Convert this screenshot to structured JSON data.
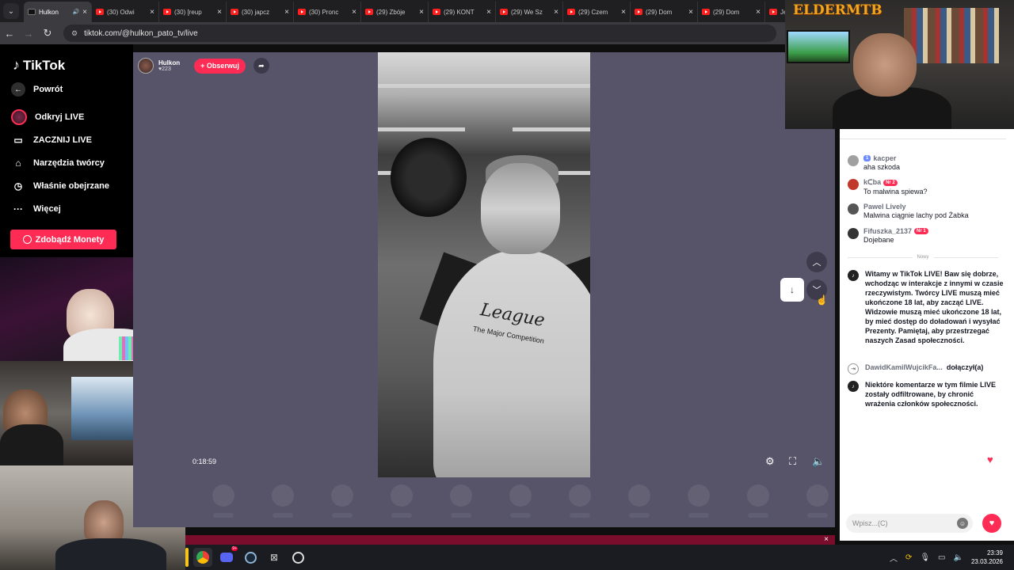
{
  "browser": {
    "tabs": [
      {
        "label": "Hulkon",
        "active": true,
        "type": "tiktok"
      },
      {
        "label": "(30) Odwi",
        "type": "youtube"
      },
      {
        "label": "(30) [reup",
        "type": "youtube"
      },
      {
        "label": "(30) japcz",
        "type": "youtube"
      },
      {
        "label": "(30) Pronc",
        "type": "youtube"
      },
      {
        "label": "(29) Zbóje",
        "type": "youtube"
      },
      {
        "label": "(29) KONT",
        "type": "youtube"
      },
      {
        "label": "(29) We Sz",
        "type": "youtube"
      },
      {
        "label": "(29) Czem",
        "type": "youtube"
      },
      {
        "label": "(29) Dom",
        "type": "youtube"
      },
      {
        "label": "(29) Dom",
        "type": "youtube"
      },
      {
        "label": "Je",
        "type": "youtube"
      }
    ],
    "url": "tiktok.com/@hulkon_pato_tv/live"
  },
  "sidebar": {
    "logo": "TikTok",
    "back": "Powrót",
    "items": [
      {
        "label": "Odkryj LIVE",
        "icon": "live-avatar-icon"
      },
      {
        "label": "ZACZNIJ LIVE",
        "icon": "video-camera-icon"
      },
      {
        "label": "Narzędzia twórcy",
        "icon": "lightbulb-icon"
      },
      {
        "label": "Właśnie obejrzane",
        "icon": "history-icon"
      },
      {
        "label": "Więcej",
        "icon": "more-dots-icon"
      }
    ],
    "coins_button": "Zdobądź Monety"
  },
  "live": {
    "host_name": "Hulkon",
    "host_likes": "223",
    "follow_label": "+ Obserwuj",
    "elapsed": "0:18:59",
    "shirt_logo": "League",
    "shirt_sub": "The Major Competition",
    "accent": "#fe2c55"
  },
  "overlay": {
    "logo_text": "ELDERMTB"
  },
  "chat": {
    "messages": [
      {
        "user": "kacper",
        "badge": "1",
        "badge_type": "lvl",
        "text": "aha szkoda",
        "avatar": "#a0a0a0"
      },
      {
        "user": "kᑕba",
        "badge": "Nr 2",
        "badge_type": "nr",
        "text": "To malwina spiewa?",
        "avatar": "#c0392b"
      },
      {
        "user": "Pawel Lively",
        "badge": "",
        "badge_type": "",
        "text": "Malwina ciągnie lachy pod Żabka",
        "avatar": "#555"
      },
      {
        "user": "Fifuszka_2137",
        "badge": "Nr 1",
        "badge_type": "nr",
        "text": "Dojebane",
        "avatar": "#333"
      }
    ],
    "new_label": "Nowy",
    "welcome": "Witamy w TikTok LIVE! Baw się dobrze, wchodząc w interakcje z innymi w czasie rzeczywistym. Twórcy LIVE muszą mieć ukończone 18 lat, aby zacząć LIVE. Widzowie muszą mieć ukończone 18 lat, by mieć dostęp do doładowań i wysyłać Prezenty. Pamiętaj, aby przestrzegać naszych Zasad społeczności.",
    "join_user": "DawidKamilWujcikFa...",
    "join_text": "dołączył(a)",
    "filter_notice": "Niektóre komentarze w tym filmie LIVE zostały odfiltrowane, by chronić wrażenia członków społeczności.",
    "input_placeholder": "Wpisz...(C)"
  },
  "taskbar": {
    "time": "23:39",
    "date": "23.03.2026",
    "discord_badge": "9+"
  }
}
